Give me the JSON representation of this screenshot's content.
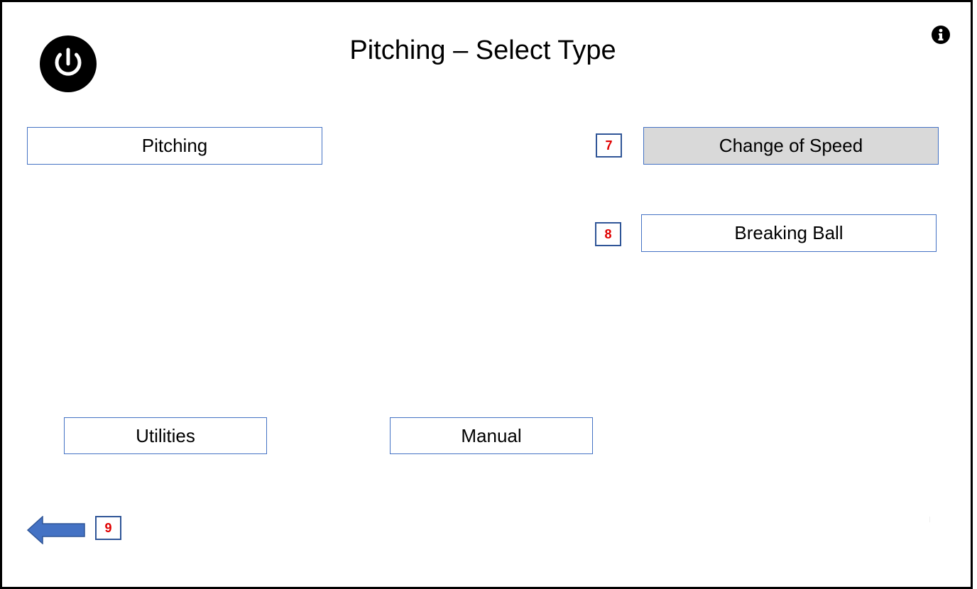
{
  "header": {
    "title": "Pitching – Select Type"
  },
  "buttons": {
    "pitching": "Pitching",
    "change_of_speed": "Change of Speed",
    "breaking_ball": "Breaking Ball",
    "utilities": "Utilities",
    "manual": "Manual"
  },
  "selected_option": "Change of Speed",
  "callouts": {
    "change_of_speed": "7",
    "breaking_ball": "8",
    "back": "9"
  },
  "icons": {
    "power": "power-icon",
    "info": "info-icon",
    "back": "left-arrow-icon"
  },
  "colors": {
    "button_border": "#4472c4",
    "selected_fill": "#d9d9d9",
    "callout_text": "#e00000",
    "callout_border": "#2f5597",
    "arrow_fill": "#4472c4"
  }
}
